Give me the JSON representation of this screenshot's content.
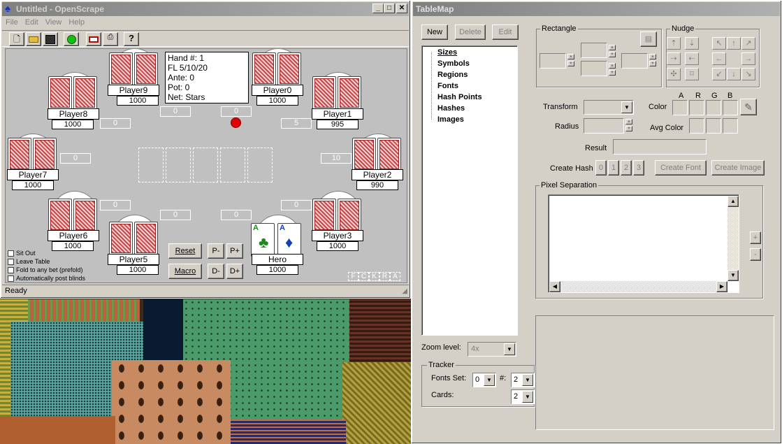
{
  "openscrape": {
    "title": "Untitled - OpenScrape",
    "menu": [
      "File",
      "Edit",
      "View",
      "Help"
    ],
    "status": "Ready",
    "info": {
      "hand": "Hand #: 1",
      "limit": "FL 5/10/20",
      "ante": "Ante: 0",
      "pot": "Pot: 0",
      "net": "Net: Stars"
    },
    "players": [
      {
        "name": "Player9",
        "balance": "1000"
      },
      {
        "name": "Player0",
        "balance": "1000"
      },
      {
        "name": "Player8",
        "balance": "1000"
      },
      {
        "name": "Player1",
        "balance": "995"
      },
      {
        "name": "Player7",
        "balance": "1000"
      },
      {
        "name": "Player2",
        "balance": "990"
      },
      {
        "name": "Player6",
        "balance": "1000"
      },
      {
        "name": "Player3",
        "balance": "1000"
      },
      {
        "name": "Player5",
        "balance": "1000"
      },
      {
        "name": "Hero",
        "balance": "1000"
      }
    ],
    "bets": {
      "p9": "0",
      "p0": "0",
      "p8": "0",
      "p1": "5",
      "p7": "0",
      "p2": "10",
      "p6": "0",
      "p5": "0",
      "hero": "0",
      "p3": "0"
    },
    "hero_cards": [
      {
        "rank": "A",
        "suit": "♣",
        "color": "#1a8a1a"
      },
      {
        "rank": "A",
        "suit": "♦",
        "color": "#1040c0"
      }
    ],
    "buttons": {
      "reset": "Reset",
      "pminus": "P-",
      "pplus": "P+",
      "macro": "Macro",
      "dminus": "D-",
      "dplus": "D+"
    },
    "checks": [
      "Sit Out",
      "Leave Table",
      "Fold to any bet (prefold)",
      "Automatically post blinds"
    ],
    "fckra": [
      "F",
      "C",
      "K",
      "R",
      "A"
    ]
  },
  "tablemap": {
    "title": "TableMap",
    "buttons": {
      "new": "New",
      "delete": "Delete",
      "edit": "Edit"
    },
    "tree": [
      "Sizes",
      "Symbols",
      "Regions",
      "Fonts",
      "Hash Points",
      "Hashes",
      "Images"
    ],
    "rectangle_label": "Rectangle",
    "nudge_label": "Nudge",
    "transform_label": "Transform",
    "radius_label": "Radius",
    "color_label": "Color",
    "avg_color_label": "Avg Color",
    "argb": [
      "A",
      "R",
      "G",
      "B"
    ],
    "result_label": "Result",
    "create_hash_label": "Create Hash",
    "hash_buttons": [
      "0",
      "1",
      "2",
      "3"
    ],
    "create_font": "Create Font",
    "create_image": "Create Image",
    "pixel_sep_label": "Pixel Separation",
    "plus": "+",
    "minus": "-",
    "zoom_label": "Zoom level:",
    "zoom_value": "4x",
    "tracker_label": "Tracker",
    "fonts_set_label": "Fonts Set:",
    "fonts_set_value": "0",
    "hash_label": "#:",
    "hash_value": "2",
    "cards_label": "Cards:",
    "cards_value": "2"
  }
}
